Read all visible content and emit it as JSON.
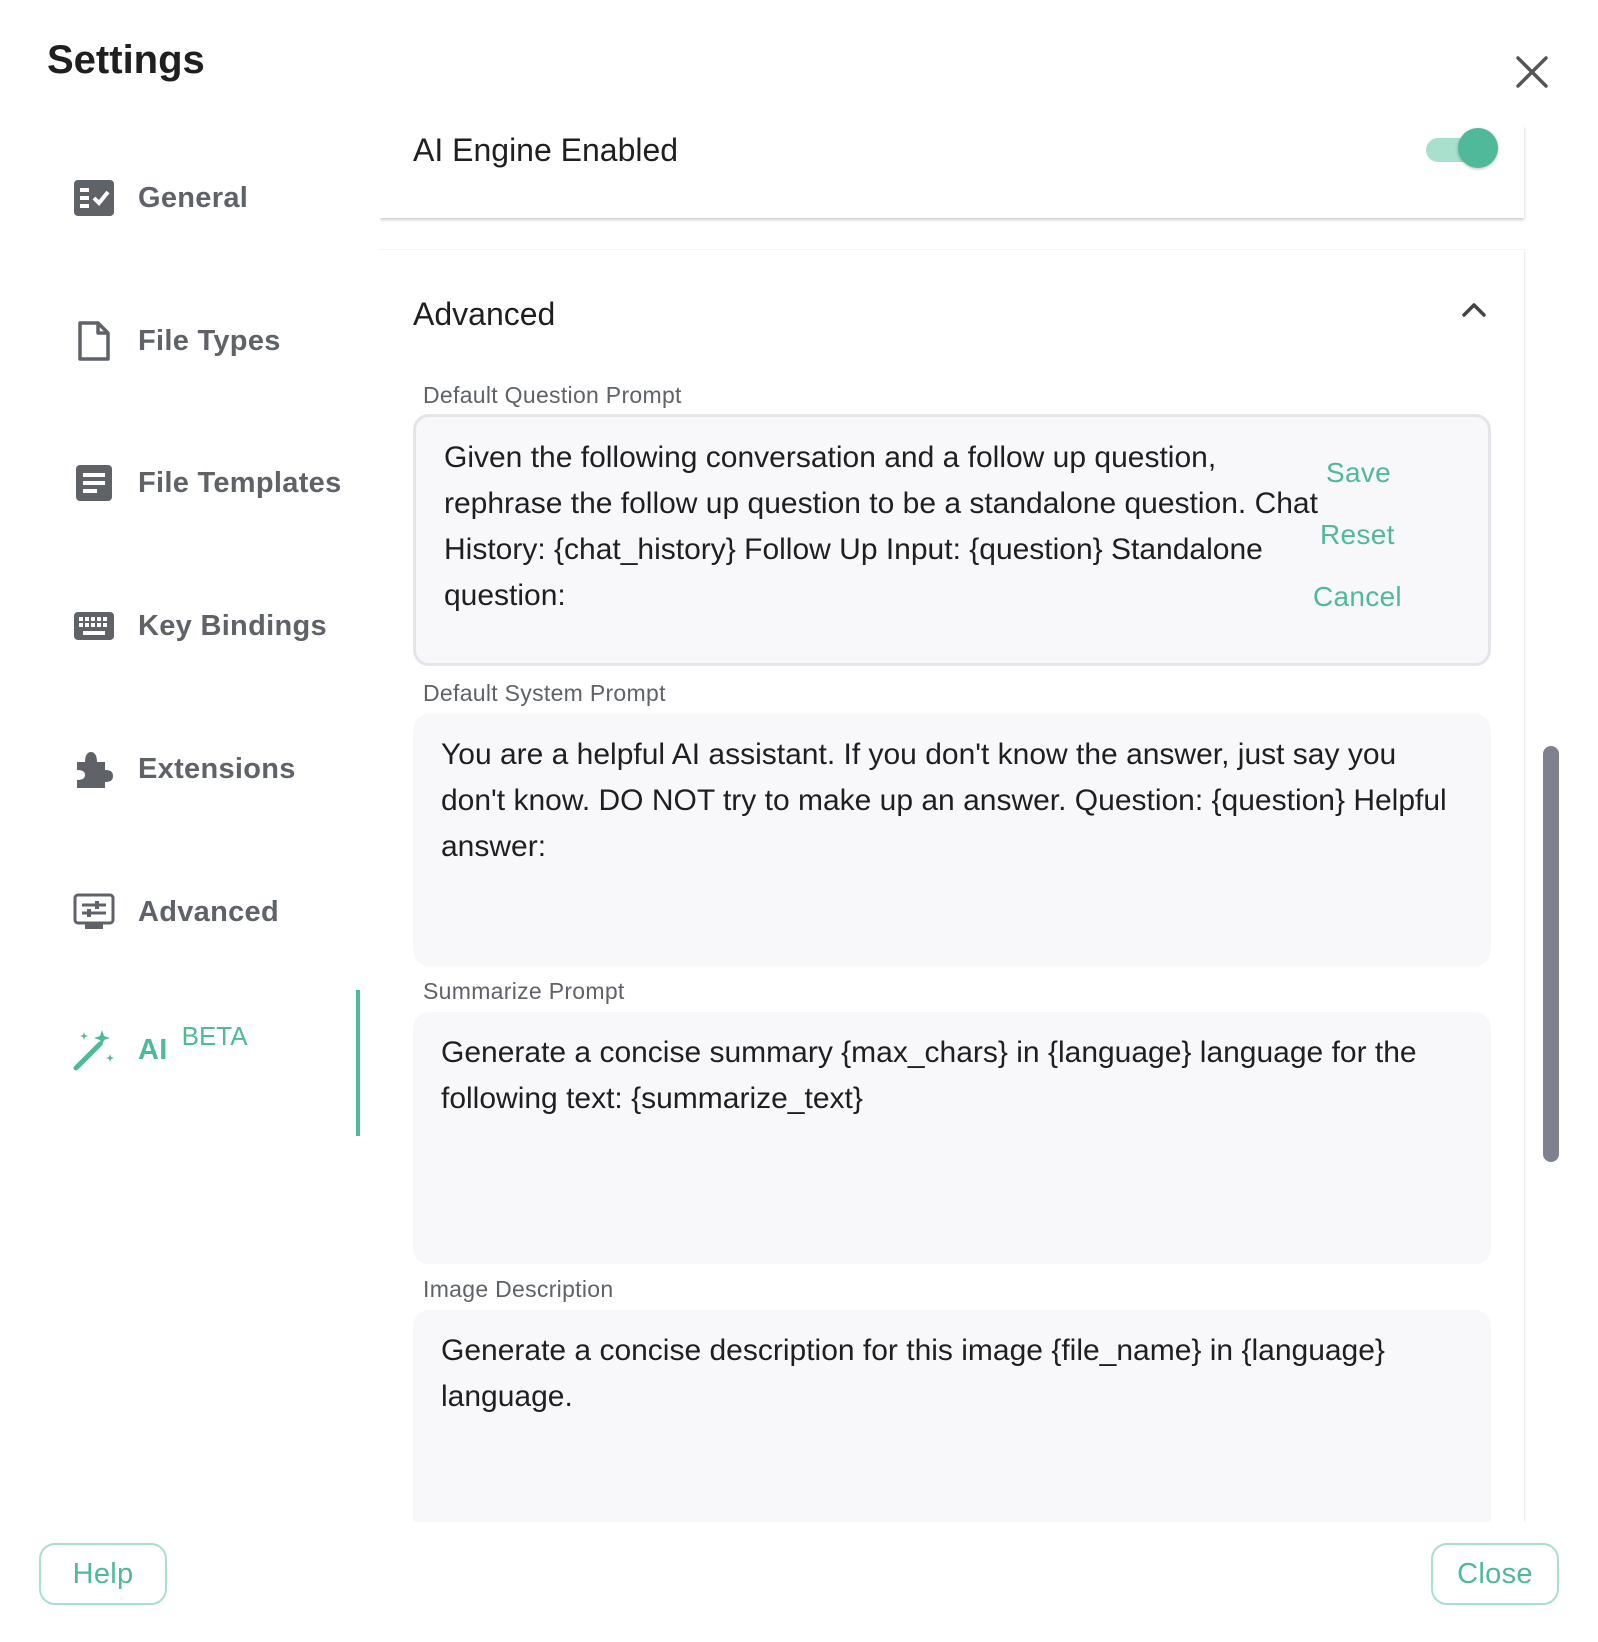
{
  "window": {
    "title": "Settings"
  },
  "sidebar": {
    "items": [
      {
        "label": "General",
        "icon": "checklist-icon"
      },
      {
        "label": "File Types",
        "icon": "file-icon"
      },
      {
        "label": "File Templates",
        "icon": "document-icon"
      },
      {
        "label": "Key Bindings",
        "icon": "keyboard-icon"
      },
      {
        "label": "Extensions",
        "icon": "puzzle-icon"
      },
      {
        "label": "Advanced",
        "icon": "settings-monitor-icon"
      },
      {
        "label": "AI",
        "badge": "BETA",
        "icon": "magic-wand-icon",
        "active": true
      }
    ]
  },
  "ai_engine": {
    "label": "AI Engine Enabled",
    "enabled": true
  },
  "advanced": {
    "title": "Advanced",
    "expanded": true,
    "fields": [
      {
        "label": "Default Question Prompt",
        "value": "Given the following conversation and a follow up question, rephrase the follow up question to be a standalone question. Chat History: {chat_history} Follow Up Input: {question} Standalone question:",
        "actions": {
          "save": "Save",
          "reset": "Reset",
          "cancel": "Cancel"
        }
      },
      {
        "label": "Default System Prompt",
        "value": "You are a helpful AI assistant. If you don't know the answer, just say you don't know. DO NOT try to make up an answer. Question: {question} Helpful answer:"
      },
      {
        "label": "Summarize Prompt",
        "value": "Generate a concise summary {max_chars} in {language} language for the following text: {summarize_text}"
      },
      {
        "label": "Image Description",
        "value": "Generate a concise description for this image {file_name} in {language} language."
      }
    ]
  },
  "footer": {
    "help": "Help",
    "close": "Close"
  },
  "colors": {
    "accent": "#4fb99a",
    "accent_light": "#a9dfcd",
    "text_muted": "#5f6368",
    "field_bg": "#f8f7fa"
  }
}
